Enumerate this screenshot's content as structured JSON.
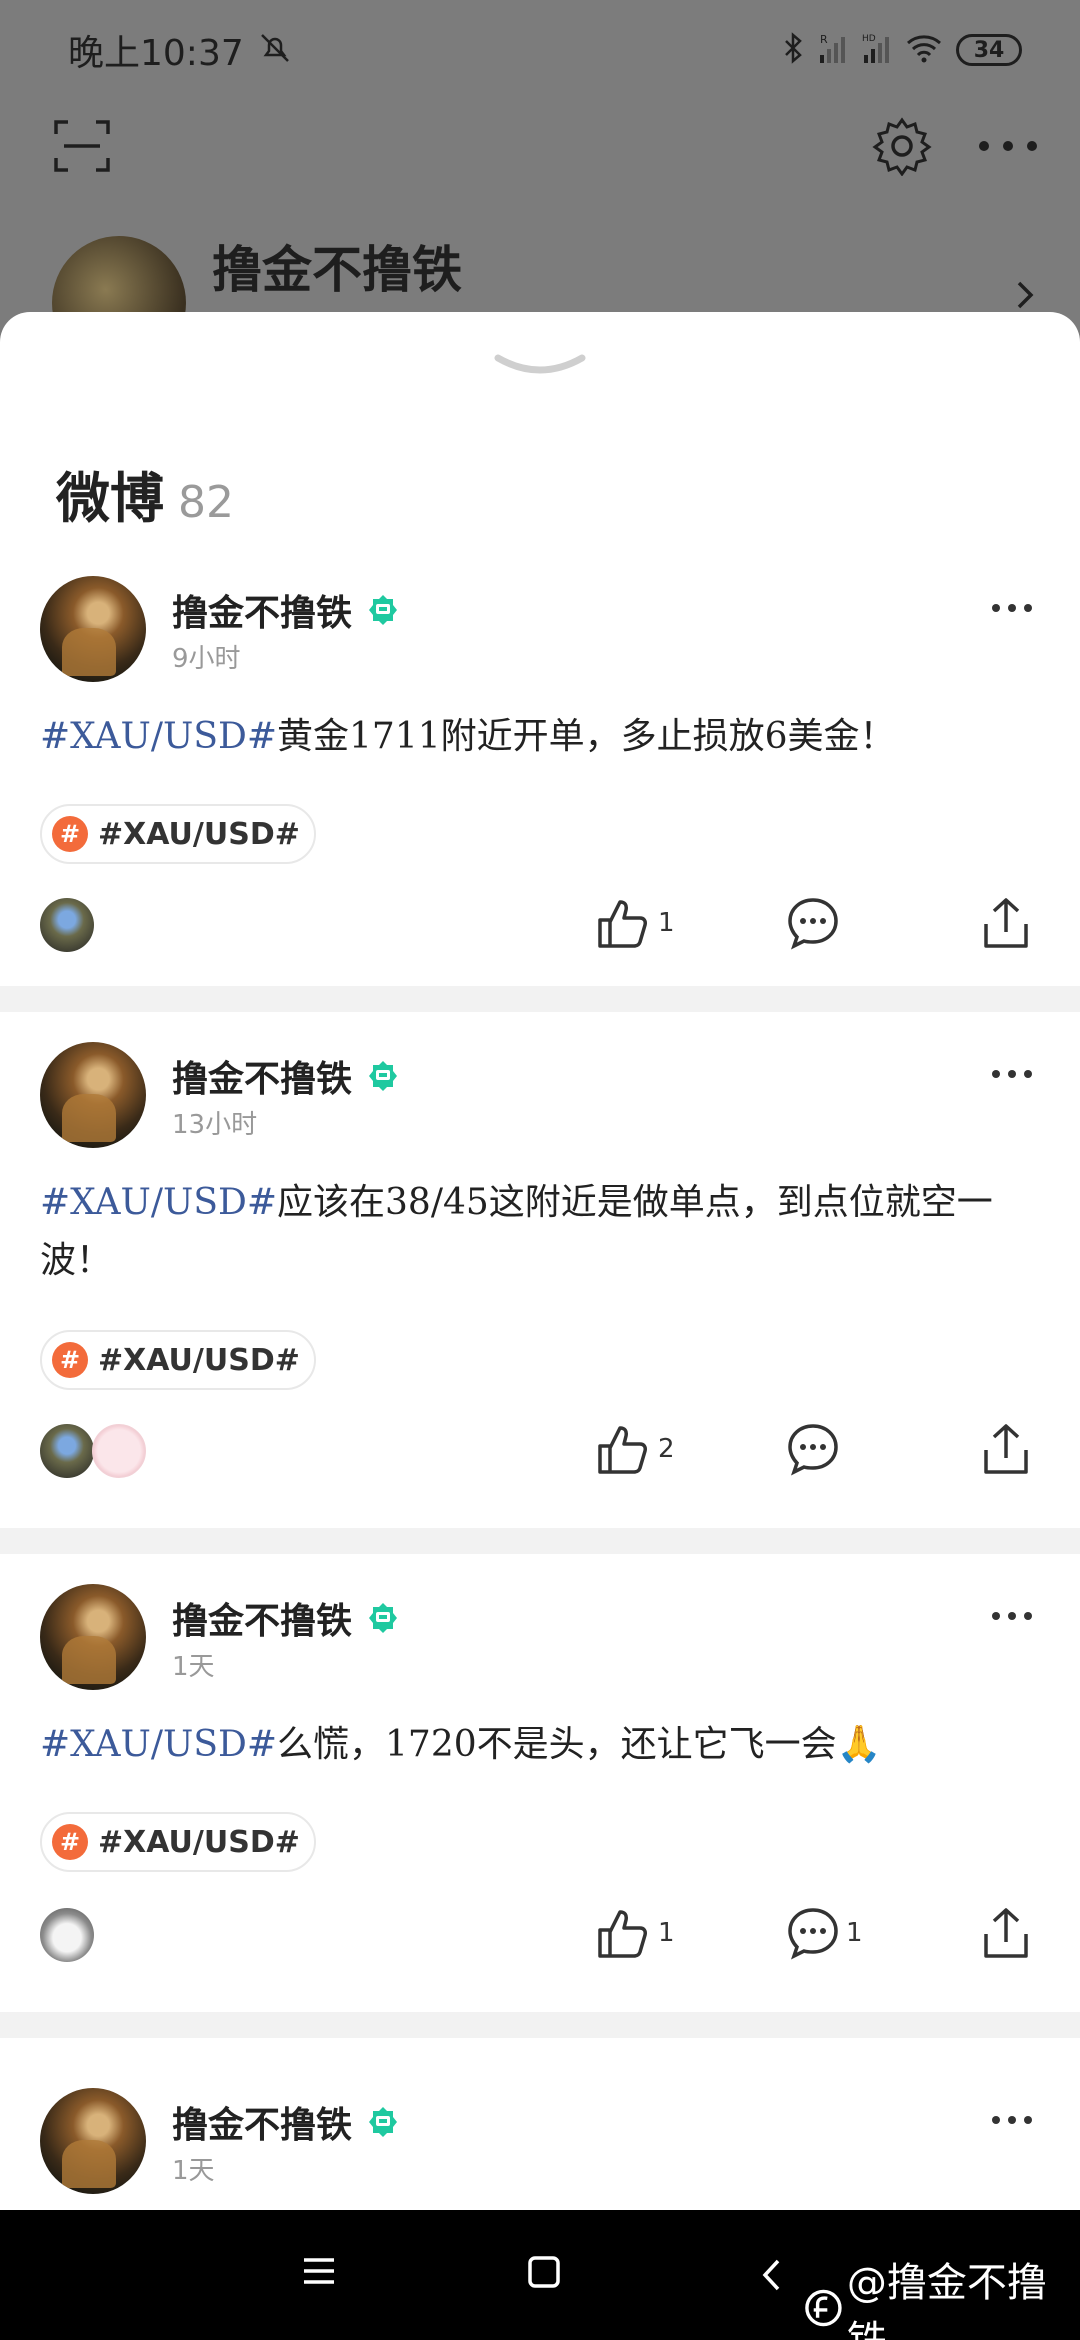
{
  "status_bar": {
    "time": "晚上10:37",
    "battery": "34",
    "icons": [
      "mute-bell-icon",
      "bluetooth-icon",
      "signal-r-icon",
      "signal-hd-icon",
      "wifi-icon",
      "battery-icon"
    ]
  },
  "header": {
    "profile_name": "撸金不撸铁",
    "icons": [
      "scan-icon",
      "gear-icon",
      "more-icon"
    ]
  },
  "sheet": {
    "title": "微博",
    "count": "82"
  },
  "posts": [
    {
      "author": "撸金不撸铁",
      "time": "9小时",
      "tag_text": "#XAU/USD#",
      "body": "黄金1711附近开单，多止损放6美金！",
      "chip_label": "#XAU/USD#",
      "likes": "1",
      "comments": "",
      "liker_avatars": [
        "mini1"
      ]
    },
    {
      "author": "撸金不撸铁",
      "time": "13小时",
      "tag_text": "#XAU/USD#",
      "body": "应该在38/45这附近是做单点，到点位就空一波！",
      "chip_label": "#XAU/USD#",
      "likes": "2",
      "comments": "",
      "liker_avatars": [
        "mini1",
        "mini2"
      ]
    },
    {
      "author": "撸金不撸铁",
      "time": "1天",
      "tag_text": "#XAU/USD#",
      "body": "么慌，1720不是头，还让它飞一会🙏",
      "chip_label": "#XAU/USD#",
      "likes": "1",
      "comments": "1",
      "liker_avatars": [
        "mini3"
      ]
    },
    {
      "author": "撸金不撸铁",
      "time": "1天"
    }
  ],
  "nav": {
    "watermark": "@撸金不撸铁"
  },
  "colors": {
    "accent_tag": "#3c5a9a",
    "verified": "#1fc9a0",
    "chip_hash": "#f36b3b"
  }
}
